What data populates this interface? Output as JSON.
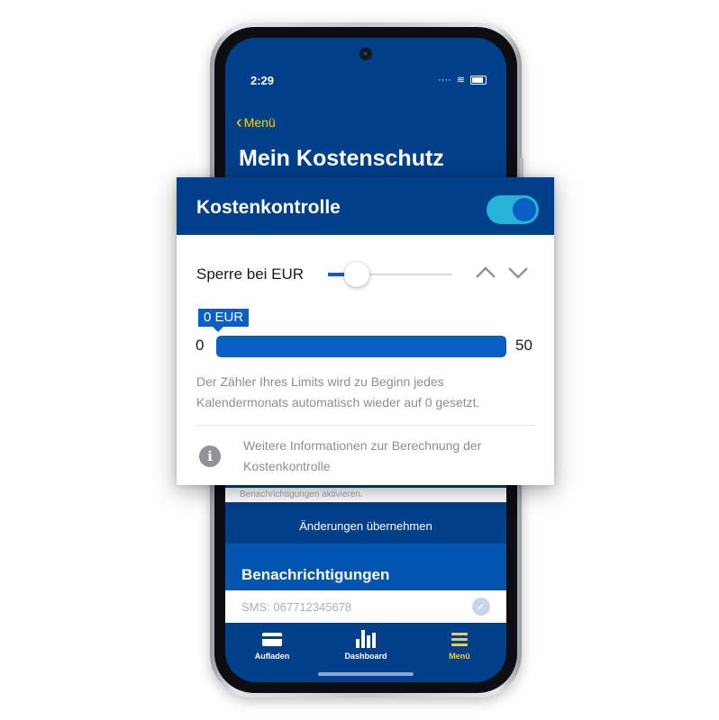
{
  "status_bar": {
    "time": "2:29",
    "signal": "····",
    "wifi": "≋"
  },
  "header": {
    "back_label": "Menü",
    "title": "Mein Kostenschutz"
  },
  "cost_control": {
    "title": "Kostenkontrolle",
    "toggle_on": true,
    "limit_label": "Sperre bei EUR",
    "slider_value_fraction": 0.0,
    "current_value_bubble": "0 EUR",
    "range_min": "0",
    "range_max": "50",
    "progress_fraction": 1.0,
    "reset_info": "Der Zähler Ihres Limits wird zu Beginn jedes Kalendermonats automatisch wieder auf 0 gesetzt.",
    "more_info_link": "Weitere Informationen zur Berechnung der Kostenkontrolle",
    "info_icon": "info-icon"
  },
  "background": {
    "partial_text": "Benachrichtigungen aktivieren.",
    "apply_button": "Änderungen übernehmen",
    "notifications_title": "Benachrichtigungen",
    "sms_label": "SMS: 067712345678",
    "sms_checked": true
  },
  "tabbar": [
    {
      "label": "Aufladen",
      "icon": "card-icon"
    },
    {
      "label": "Dashboard",
      "icon": "bar-chart-icon"
    },
    {
      "label": "Menü",
      "icon": "menu-icon",
      "active": true
    }
  ],
  "colors": {
    "brand_blue": "#003f8a",
    "accent_yellow": "#ffd200",
    "toggle_cyan": "#27b3d8",
    "control_blue": "#0a5fc4"
  }
}
